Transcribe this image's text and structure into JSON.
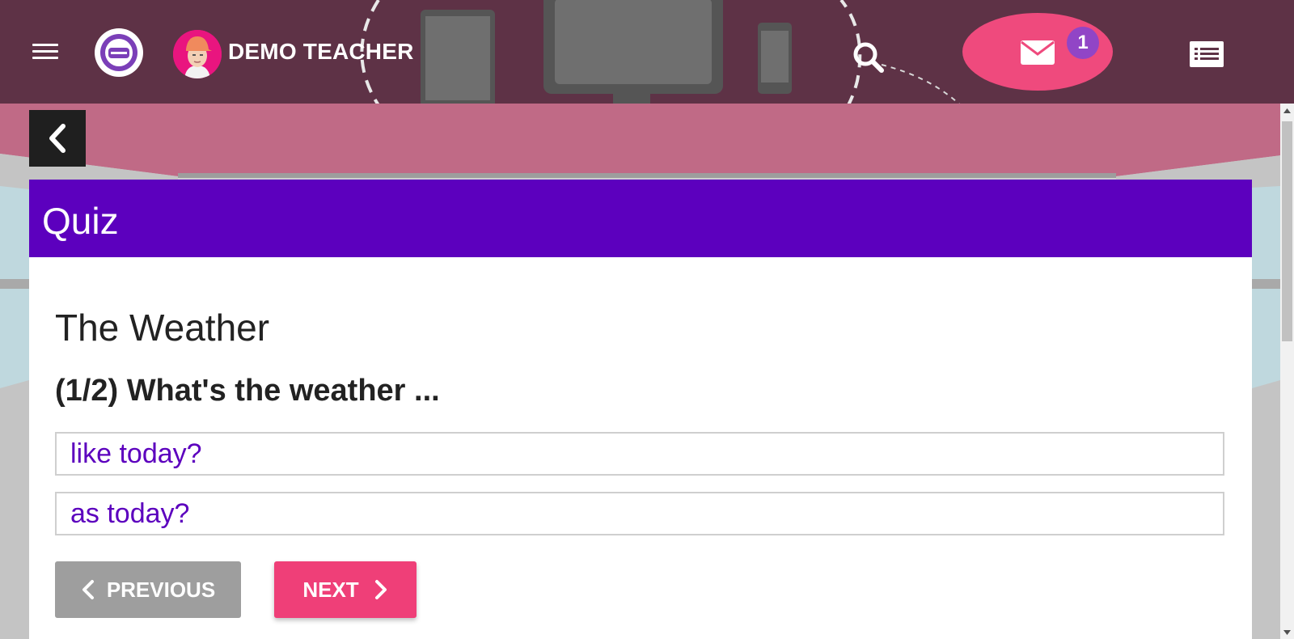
{
  "header": {
    "user_name": "DEMO TEACHER",
    "mail_badge_count": "1"
  },
  "card": {
    "header_title": "Quiz",
    "quiz_title": "The Weather",
    "question": "(1/2) What's the weather ...",
    "answers": [
      "like today?",
      "as today?"
    ],
    "previous_label": "PREVIOUS",
    "next_label": "NEXT"
  },
  "colors": {
    "header_bg": "#5e3246",
    "card_header_bg": "#5c00be",
    "answer_text": "#5c00be",
    "next_button": "#ef3f78",
    "previous_button": "#9e9e9e",
    "mail_button": "#ef4a7d",
    "badge": "#9145c6"
  },
  "icons": [
    "menu-icon",
    "logo-icon",
    "avatar-icon",
    "search-icon",
    "mail-icon",
    "list-icon",
    "chevron-left-icon",
    "chevron-right-icon"
  ]
}
